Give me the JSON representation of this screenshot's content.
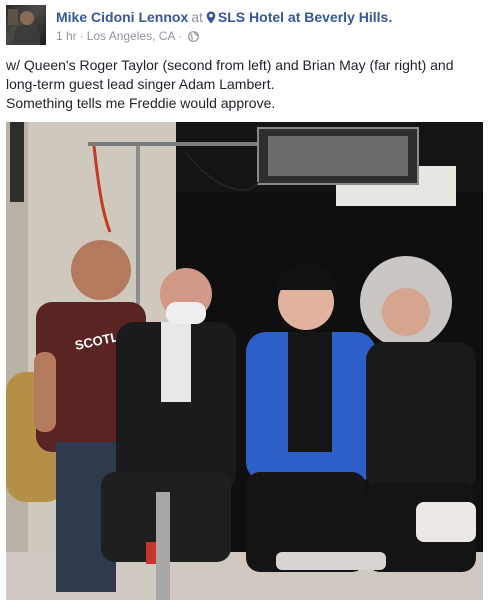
{
  "post": {
    "author": "Mike Cidoni Lennox",
    "at_word": "at",
    "place": "SLS Hotel at Beverly Hills.",
    "time": "1 hr",
    "location": "Los Angeles, CA",
    "dot": "·",
    "caption_lines": [
      "w/ Queen's Roger Taylor (second from left) and Brian May (far right) and long-term guest lead singer Adam Lambert.",
      "Something tells me Freddie would approve."
    ],
    "shirt_text": "SCOTLAND"
  },
  "colors": {
    "link": "#365899",
    "meta": "#90949c",
    "text": "#1d2129"
  },
  "icons": {
    "place": "map-pin-icon",
    "privacy": "globe-icon"
  }
}
